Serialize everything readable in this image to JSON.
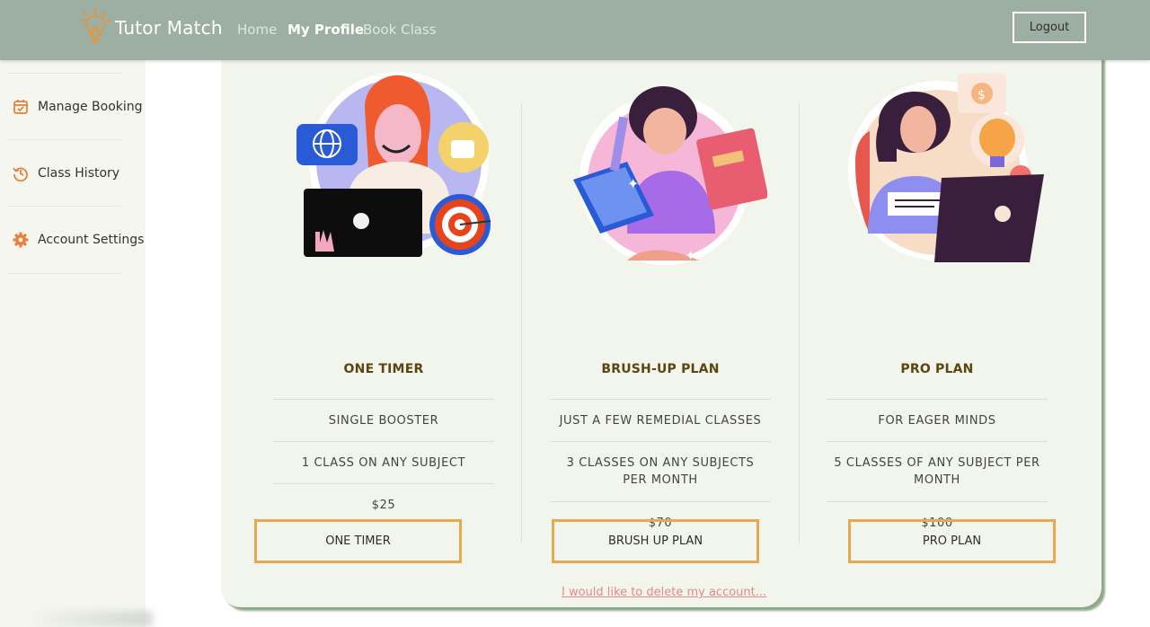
{
  "brand": {
    "name": "Tutor Match",
    "icon": "lightbulb-icon"
  },
  "nav": {
    "home": "Home",
    "my_profile": "My Profile",
    "book_class": "Book Class",
    "logout": "Logout"
  },
  "sidebar": {
    "items": [
      {
        "label": "Manage Booking",
        "icon": "calendar-check-icon"
      },
      {
        "label": "Class History",
        "icon": "history-icon"
      },
      {
        "label": "Account Settings",
        "icon": "gear-icon"
      }
    ]
  },
  "plans": [
    {
      "title": "ONE TIMER",
      "rows": [
        "SINGLE BOOSTER",
        "1 CLASS ON ANY SUBJECT",
        "$25"
      ],
      "button": "ONE TIMER"
    },
    {
      "title": "BRUSH-UP PLAN",
      "rows": [
        "JUST A FEW REMEDIAL CLASSES",
        "3 CLASSES ON ANY SUBJECTS PER MONTH",
        "$70"
      ],
      "button": "BRUSH UP PLAN"
    },
    {
      "title": "PRO PLAN",
      "rows": [
        "FOR EAGER MINDS",
        "5 CLASSES OF ANY SUBJECT PER MONTH",
        "$100"
      ],
      "button": "PRO PLAN"
    }
  ],
  "delete_account": "I would like to delete my account...",
  "colors": {
    "navbar": "#9dafa3",
    "accent": "#e8a84e",
    "icon": "#e8803a",
    "card": "#f2f5ec",
    "link": "#e88787"
  }
}
